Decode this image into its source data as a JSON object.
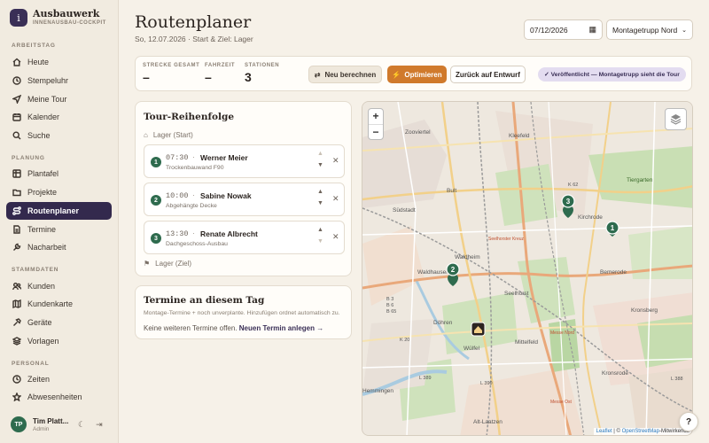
{
  "app": {
    "title": "Ausbauwerk",
    "subtitle": "INNENAUSBAU-COCKPIT",
    "logo_glyph": "i"
  },
  "sidebar": {
    "sections": [
      {
        "label": "ARBEITSTAG",
        "items": [
          {
            "label": "Heute",
            "icon": "home-icon"
          },
          {
            "label": "Stempeluhr",
            "icon": "clock-icon"
          },
          {
            "label": "Meine Tour",
            "icon": "navigation-icon"
          },
          {
            "label": "Kalender",
            "icon": "calendar-icon"
          },
          {
            "label": "Suche",
            "icon": "search-icon"
          }
        ]
      },
      {
        "label": "PLANUNG",
        "items": [
          {
            "label": "Plantafel",
            "icon": "grid-icon"
          },
          {
            "label": "Projekte",
            "icon": "folder-icon"
          },
          {
            "label": "Routenplaner",
            "icon": "route-icon",
            "active": true
          },
          {
            "label": "Termine",
            "icon": "document-icon"
          },
          {
            "label": "Nacharbeit",
            "icon": "wrench-icon"
          }
        ]
      },
      {
        "label": "STAMMDATEN",
        "items": [
          {
            "label": "Kunden",
            "icon": "users-icon"
          },
          {
            "label": "Kundenkarte",
            "icon": "map-icon"
          },
          {
            "label": "Geräte",
            "icon": "hammer-icon"
          },
          {
            "label": "Vorlagen",
            "icon": "layers-icon"
          }
        ]
      },
      {
        "label": "PERSONAL",
        "items": [
          {
            "label": "Zeiten",
            "icon": "clock-icon"
          },
          {
            "label": "Abwesenheiten",
            "icon": "star-icon"
          }
        ]
      }
    ],
    "user": {
      "initials": "TP",
      "name": "Tim Platt...",
      "role": "Admin"
    }
  },
  "header": {
    "title": "Routenplaner",
    "subtitle": "So, 12.07.2026 · Start & Ziel: Lager",
    "date_value": "07/12/2026",
    "crew_value": "Montagetrupp Nord"
  },
  "stats": {
    "distance_label": "STRECKE GESAMT",
    "distance_value": "–",
    "duration_label": "FAHRZEIT",
    "duration_value": "–",
    "stations_label": "STATIONEN",
    "stations_value": "3",
    "recalc_label": "Neu berechnen",
    "optimize_label": "Optimieren",
    "revert_label": "Zurück auf Entwurf",
    "published_label": "✓ Veröffentlicht — Montagetrupp sieht die Tour"
  },
  "tour": {
    "title": "Tour-Reihenfolge",
    "start_label": "Lager (Start)",
    "end_label": "Lager (Ziel)",
    "stops": [
      {
        "num": "1",
        "time": "07:30",
        "name": "Werner Meier",
        "desc": "Trockenbauwand F90"
      },
      {
        "num": "2",
        "time": "10:00",
        "name": "Sabine Nowak",
        "desc": "Abgehängte Decke"
      },
      {
        "num": "3",
        "time": "13:30",
        "name": "Renate Albrecht",
        "desc": "Dachgeschoss-Ausbau"
      }
    ]
  },
  "appointments": {
    "title": "Termine an diesem Tag",
    "subtitle": "Montage-Termine + noch unverplante. Hinzufügen ordnet automatisch zu.",
    "empty_text": "Keine weiteren Termine offen.",
    "new_link": "Neuen Termin anlegen →"
  },
  "map": {
    "zoom_in": "+",
    "zoom_out": "−",
    "attribution_leaflet": "Leaflet",
    "attribution_rest": " | © ",
    "attribution_osm": "OpenStreetMap",
    "attribution_tail": "-Mitwirkende",
    "labels": [
      {
        "text": "Zooviertel"
      },
      {
        "text": "Kleefeld"
      },
      {
        "text": "Tiergarten"
      },
      {
        "text": "Südstadt"
      },
      {
        "text": "Bult"
      },
      {
        "text": "Kirchrode"
      },
      {
        "text": "Waldhausen"
      },
      {
        "text": "Waldheim"
      },
      {
        "text": "Bemerode"
      },
      {
        "text": "Seelhorst"
      },
      {
        "text": "Döhren"
      },
      {
        "text": "Kronsberg"
      },
      {
        "text": "Mittelfeld"
      },
      {
        "text": "Wülfel"
      },
      {
        "text": "Kronsrode"
      },
      {
        "text": "Alt-Laatzen"
      },
      {
        "text": "Hemmingen"
      },
      {
        "text": "K 62"
      },
      {
        "text": "K 20"
      },
      {
        "text": "L 389"
      },
      {
        "text": "L 388"
      },
      {
        "text": "L 390"
      },
      {
        "text": "B 3"
      },
      {
        "text": "B 6"
      },
      {
        "text": "B 65"
      },
      {
        "text": "Seelhorster Kreuz"
      },
      {
        "text": "Messe Nord"
      },
      {
        "text": "Messe Ost"
      }
    ],
    "markers": [
      "1",
      "2",
      "3"
    ]
  },
  "help_label": "?",
  "colors": {
    "accent": "#33294d",
    "green": "#2e6b4e",
    "orange": "#d07a2c"
  }
}
